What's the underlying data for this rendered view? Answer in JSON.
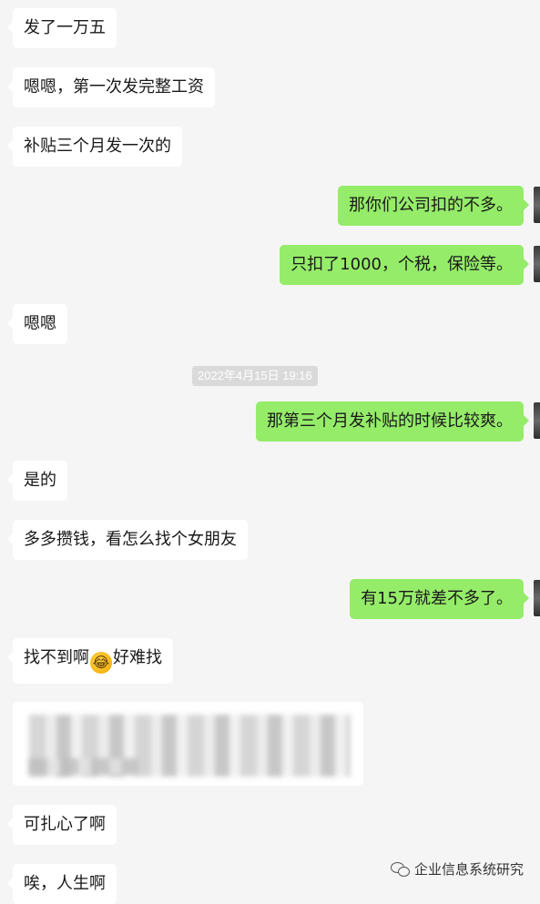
{
  "messages": [
    {
      "text": "发了一万五"
    },
    {
      "text": "嗯嗯，第一次发完整工资"
    },
    {
      "text": "补贴三个月发一次的"
    },
    {
      "text": "那你们公司扣的不多。"
    },
    {
      "text": "只扣了1000，个税，保险等。"
    },
    {
      "text": "嗯嗯"
    },
    {
      "text": "那第三个月发补贴的时候比较爽。"
    },
    {
      "text": "是的"
    },
    {
      "text": "多多攒钱，看怎么找个女朋友"
    },
    {
      "text": "有15万就差不多了。"
    },
    {
      "text_before": "找不到啊",
      "emoji": "😂",
      "text_after": "好难找"
    },
    {
      "text": "可扎心了啊"
    },
    {
      "text": "唉，人生啊"
    }
  ],
  "timestamp": "2022年4月15日 19:16",
  "watermark": "企业信息系统研究",
  "colors": {
    "incoming_bubble": "#ffffff",
    "outgoing_bubble": "#95ec69",
    "background": "#f5f5f5"
  }
}
